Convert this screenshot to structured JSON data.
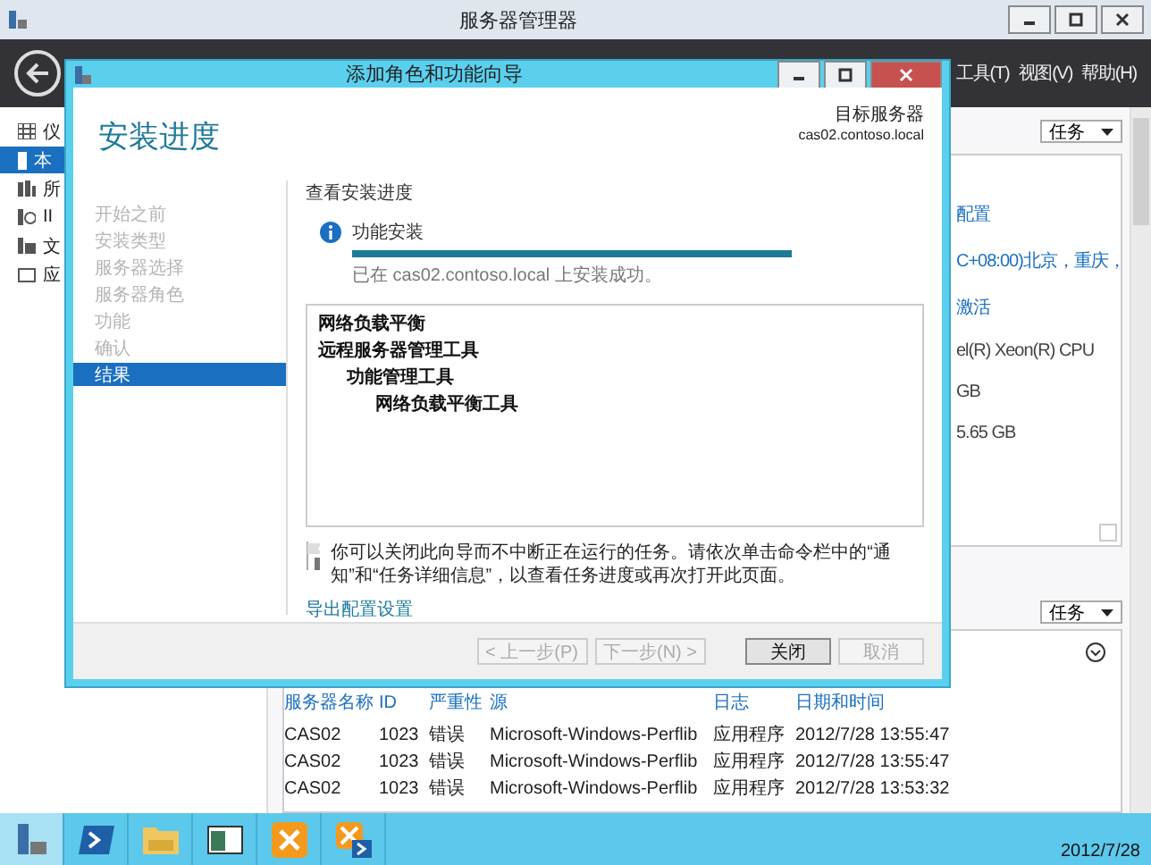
{
  "window": {
    "title": "服务器管理器"
  },
  "menu": [
    "工具(T)",
    "视图(V)",
    "帮助(H)"
  ],
  "nav": [
    {
      "label": "仪",
      "kind": "dashboard",
      "selected": false
    },
    {
      "label": "本",
      "kind": "server",
      "selected": true
    },
    {
      "label": "所",
      "kind": "servers",
      "selected": false
    },
    {
      "label": "II",
      "kind": "iis",
      "selected": false
    },
    {
      "label": "文",
      "kind": "files",
      "selected": false
    },
    {
      "label": "应",
      "kind": "app",
      "selected": false
    }
  ],
  "properties": {
    "tasks": "任务",
    "lines": [
      {
        "text": "配置",
        "kind": "link"
      },
      {
        "text": "C+08:00)北京，重庆，",
        "kind": "link"
      },
      {
        "text": "激活",
        "kind": "link"
      },
      {
        "text": "el(R) Xeon(R) CPU",
        "kind": "value"
      },
      {
        "text": "GB",
        "kind": "value"
      },
      {
        "text": "5.65 GB",
        "kind": "value"
      }
    ]
  },
  "events": {
    "tasks": "任务",
    "columns": [
      "服务器名称",
      "ID",
      "严重性",
      "源",
      "日志",
      "日期和时间"
    ],
    "rows": [
      [
        "CAS02",
        "1023",
        "错误",
        "Microsoft-Windows-Perflib",
        "应用程序",
        "2012/7/28 13:55:47"
      ],
      [
        "CAS02",
        "1023",
        "错误",
        "Microsoft-Windows-Perflib",
        "应用程序",
        "2012/7/28 13:55:47"
      ],
      [
        "CAS02",
        "1023",
        "错误",
        "Microsoft-Windows-Perflib",
        "应用程序",
        "2012/7/28 13:53:32"
      ]
    ]
  },
  "dialog": {
    "title": "添加角色和功能向导",
    "heading": "安装进度",
    "target_label": "目标服务器",
    "target": "cas02.contoso.local",
    "steps": [
      {
        "label": "开始之前",
        "selected": false
      },
      {
        "label": "安装类型",
        "selected": false
      },
      {
        "label": "服务器选择",
        "selected": false
      },
      {
        "label": "服务器角色",
        "selected": false
      },
      {
        "label": "功能",
        "selected": false
      },
      {
        "label": "确认",
        "selected": false
      },
      {
        "label": "结果",
        "selected": true
      }
    ],
    "section": "查看安装进度",
    "status": "功能安装",
    "level": 1,
    "result": "已在 cas02.contoso.local 上安装成功。",
    "features": [
      {
        "label": "网络负载平衡"
      },
      {
        "label": "远程服务器管理工具",
        "children": [
          {
            "label": "功能管理工具",
            "children": [
              {
                "label": "网络负载平衡工具"
              }
            ]
          }
        ]
      }
    ],
    "note": "你可以关闭此向导而不中断正在运行的任务。请依次单击命令栏中的“通知”和“任务详细信息”，以查看任务进度或再次打开此页面。",
    "link": "导出配置设置",
    "buttons": [
      {
        "label": "< 上一步(P)",
        "disabled": true
      },
      {
        "label": "下一步(N) >",
        "disabled": true
      },
      {
        "label": "关闭",
        "disabled": false
      },
      {
        "label": "取消",
        "disabled": true
      }
    ]
  },
  "taskbar": {
    "apps": [
      {
        "kind": "server",
        "selected": true
      },
      {
        "kind": "shell",
        "selected": false
      },
      {
        "kind": "folder",
        "selected": false
      },
      {
        "kind": "window",
        "selected": false
      },
      {
        "kind": "exchange",
        "selected": false
      },
      {
        "kind": "exchange-shell",
        "selected": false
      }
    ],
    "date": "2012/7/28"
  }
}
